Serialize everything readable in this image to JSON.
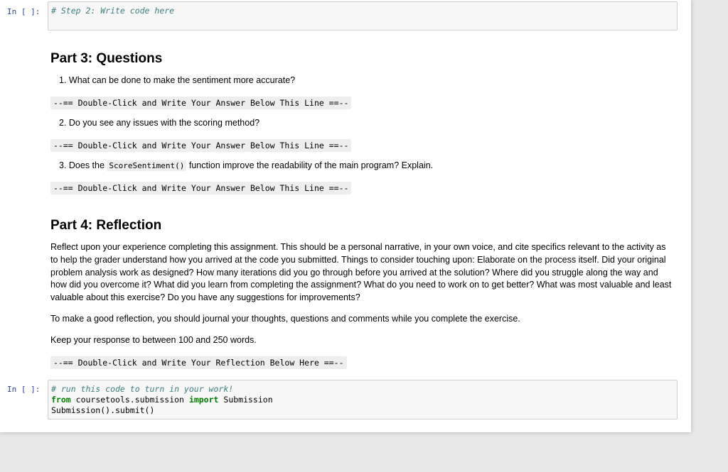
{
  "cells": {
    "prompt_label": "In [ ]:",
    "step2_comment": "# Step 2: Write code here",
    "submit_comment": "# run this code to turn in your work!",
    "submit_from": "from",
    "submit_module": "coursetools.submission",
    "submit_import": "import",
    "submit_name": "Submission",
    "submit_call": "Submission().submit()"
  },
  "part3": {
    "heading": "Part 3: Questions",
    "q1": "1. What can be done to make the sentiment more accurate?",
    "q2": "2. Do you see any issues with the scoring method?",
    "q3_pre": "3. Does the",
    "q3_code": "ScoreSentiment()",
    "q3_post": "function improve the readability of the main program? Explain.",
    "answer_line": "--== Double-Click and Write Your Answer Below This Line ==--"
  },
  "part4": {
    "heading": "Part 4: Reflection",
    "paragraph": "Reflect upon your experience completing this assignment. This should be a personal narrative, in your own voice, and cite specifics relevant to the activity as to help the grader understand how you arrived at the code you submitted. Things to consider touching upon: Elaborate on the process itself. Did your original problem analysis work as designed? How many iterations did you go through before you arrived at the solution? Where did you struggle along the way and how did you overcome it? What did you learn from completing the assignment? What do you need to work on to get better? What was most valuable and least valuable about this exercise? Do you have any suggestions for improvements?",
    "journal": "To make a good reflection, you should journal your thoughts, questions and comments while you complete the exercise.",
    "word_count": "Keep your response to between 100 and 250 words.",
    "reflection_line": "--== Double-Click and Write Your Reflection Below Here ==--"
  },
  "colors": {
    "prompt": "#303f9f",
    "comment": "#408080",
    "keyword": "#008000"
  }
}
